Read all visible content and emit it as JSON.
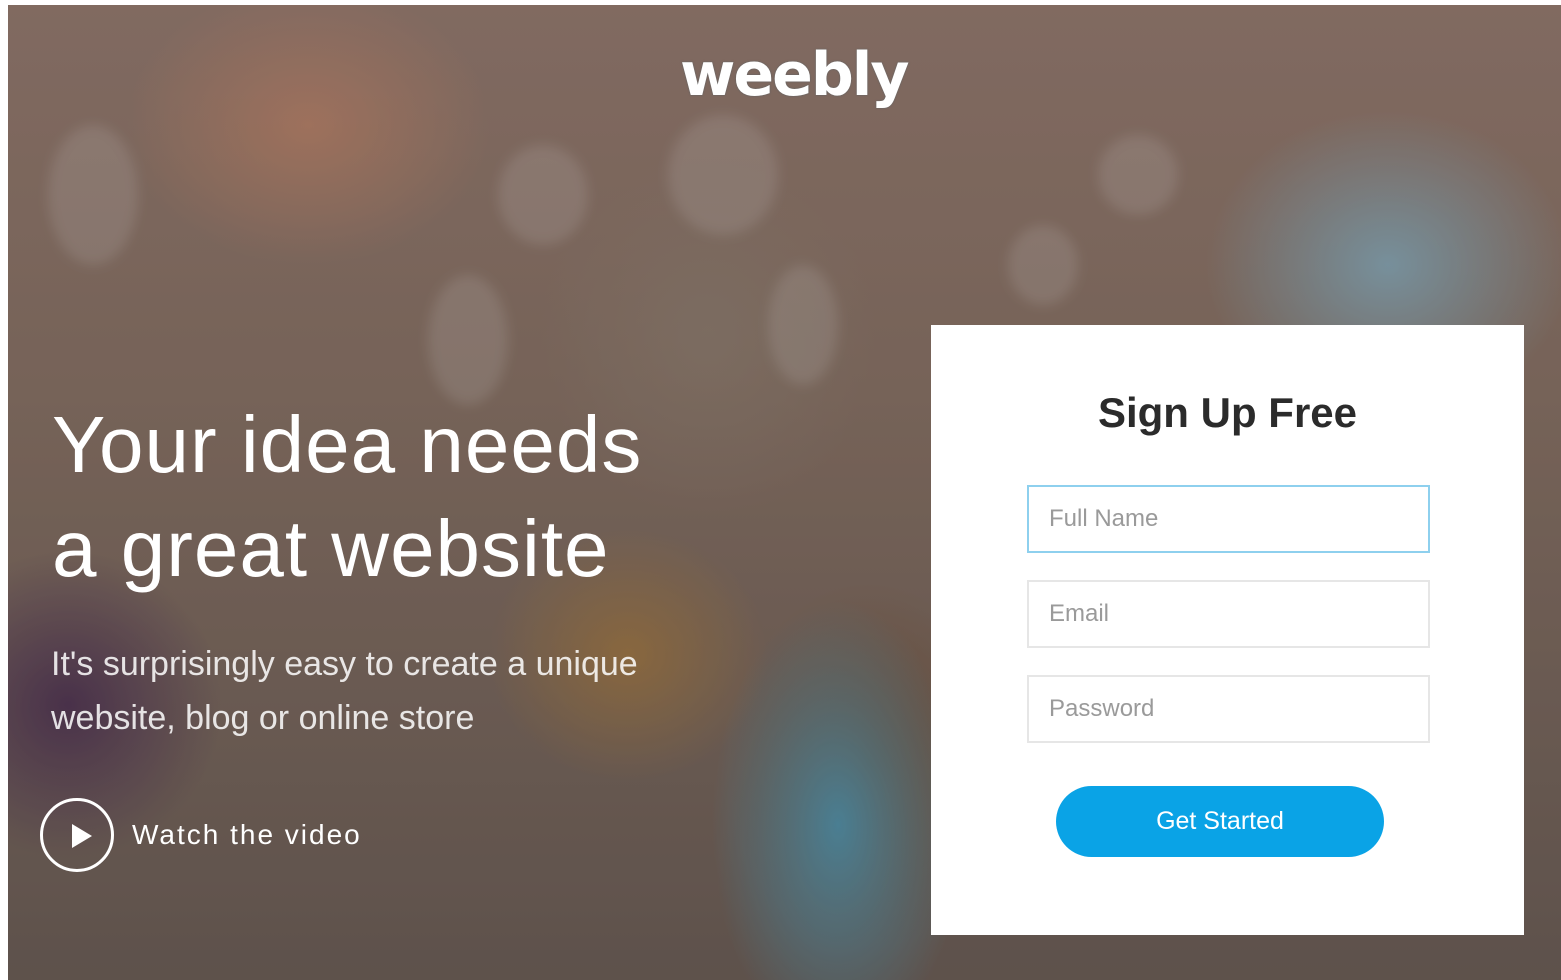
{
  "brand": {
    "logo_text": "weebly"
  },
  "hero": {
    "headline_line1": "Your idea needs",
    "headline_line2": "a great website",
    "subtext_line1": "It's surprisingly easy to create a unique",
    "subtext_line2": "website, blog or online store",
    "video_link_label": "Watch the video",
    "video_icon": "play-icon"
  },
  "signup": {
    "title": "Sign Up Free",
    "full_name": {
      "placeholder": "Full Name",
      "value": ""
    },
    "email": {
      "placeholder": "Email",
      "value": ""
    },
    "password": {
      "placeholder": "Password",
      "value": ""
    },
    "submit_label": "Get Started"
  },
  "colors": {
    "accent": "#0aa3e6",
    "focus_border": "#8ed0ee",
    "card_background": "#ffffff"
  }
}
